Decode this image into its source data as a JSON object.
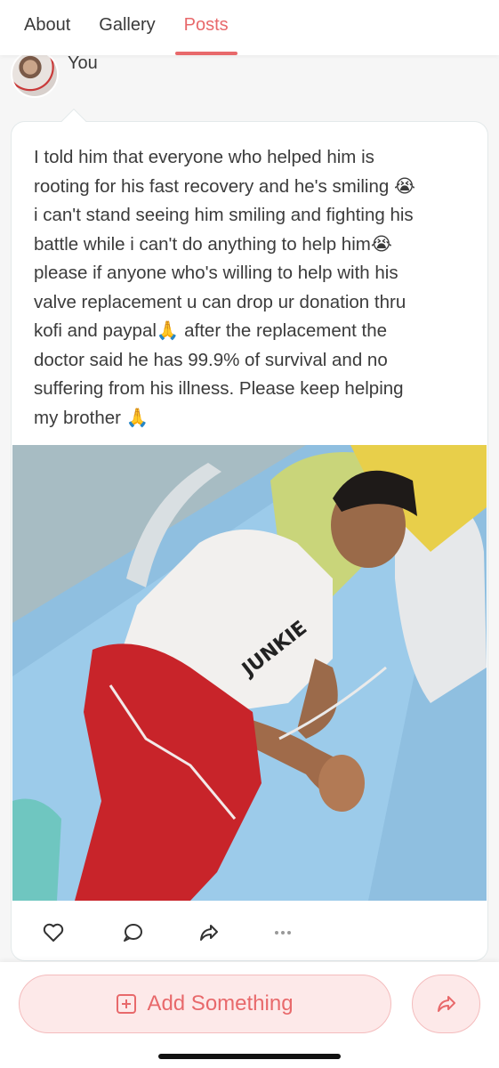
{
  "nav": {
    "tabs": [
      {
        "label": "About"
      },
      {
        "label": "Gallery"
      },
      {
        "label": "Posts",
        "active": true
      }
    ],
    "accent_color": "#e8696b"
  },
  "post": {
    "author": "You",
    "text": "I told him that everyone who helped him is\nrooting for his fast recovery and he's smiling 😭\ni can't stand seeing him smiling and fighting his\nbattle while i can't do anything to help him😭\nplease if anyone who's willing to help with his\nvalve replacement u can drop ur donation thru\nkofi and paypal🙏 after the replacement the\ndoctor said he has 99.9% of survival and no\nsuffering from his illness. Please keep helping\nmy brother 🙏",
    "photo_shirt_text": "JUNKIE",
    "actions": [
      "heart-icon",
      "comment-icon",
      "share-icon",
      "more-icon"
    ]
  },
  "bottom": {
    "add_label": "Add Something",
    "share_icon": "share-icon"
  }
}
